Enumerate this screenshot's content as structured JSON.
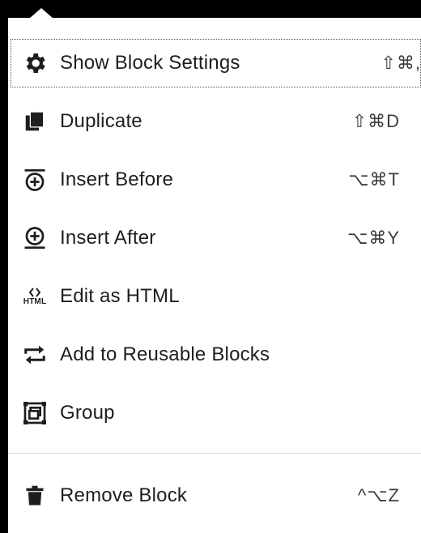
{
  "menu": {
    "items": [
      {
        "label": "Show Block Settings",
        "shortcut": "⇧⌘,",
        "icon": "gear-icon"
      },
      {
        "label": "Duplicate",
        "shortcut": "⇧⌘D",
        "icon": "duplicate-icon"
      },
      {
        "label": "Insert Before",
        "shortcut": "⌥⌘T",
        "icon": "insert-before-icon"
      },
      {
        "label": "Insert After",
        "shortcut": "⌥⌘Y",
        "icon": "insert-after-icon"
      },
      {
        "label": "Edit as HTML",
        "shortcut": "",
        "icon": "html-icon",
        "icon_text": "HTML"
      },
      {
        "label": "Add to Reusable Blocks",
        "shortcut": "",
        "icon": "reusable-icon"
      },
      {
        "label": "Group",
        "shortcut": "",
        "icon": "group-icon"
      },
      {
        "label": "Remove Block",
        "shortcut": "^⌥Z",
        "icon": "trash-icon"
      }
    ]
  }
}
